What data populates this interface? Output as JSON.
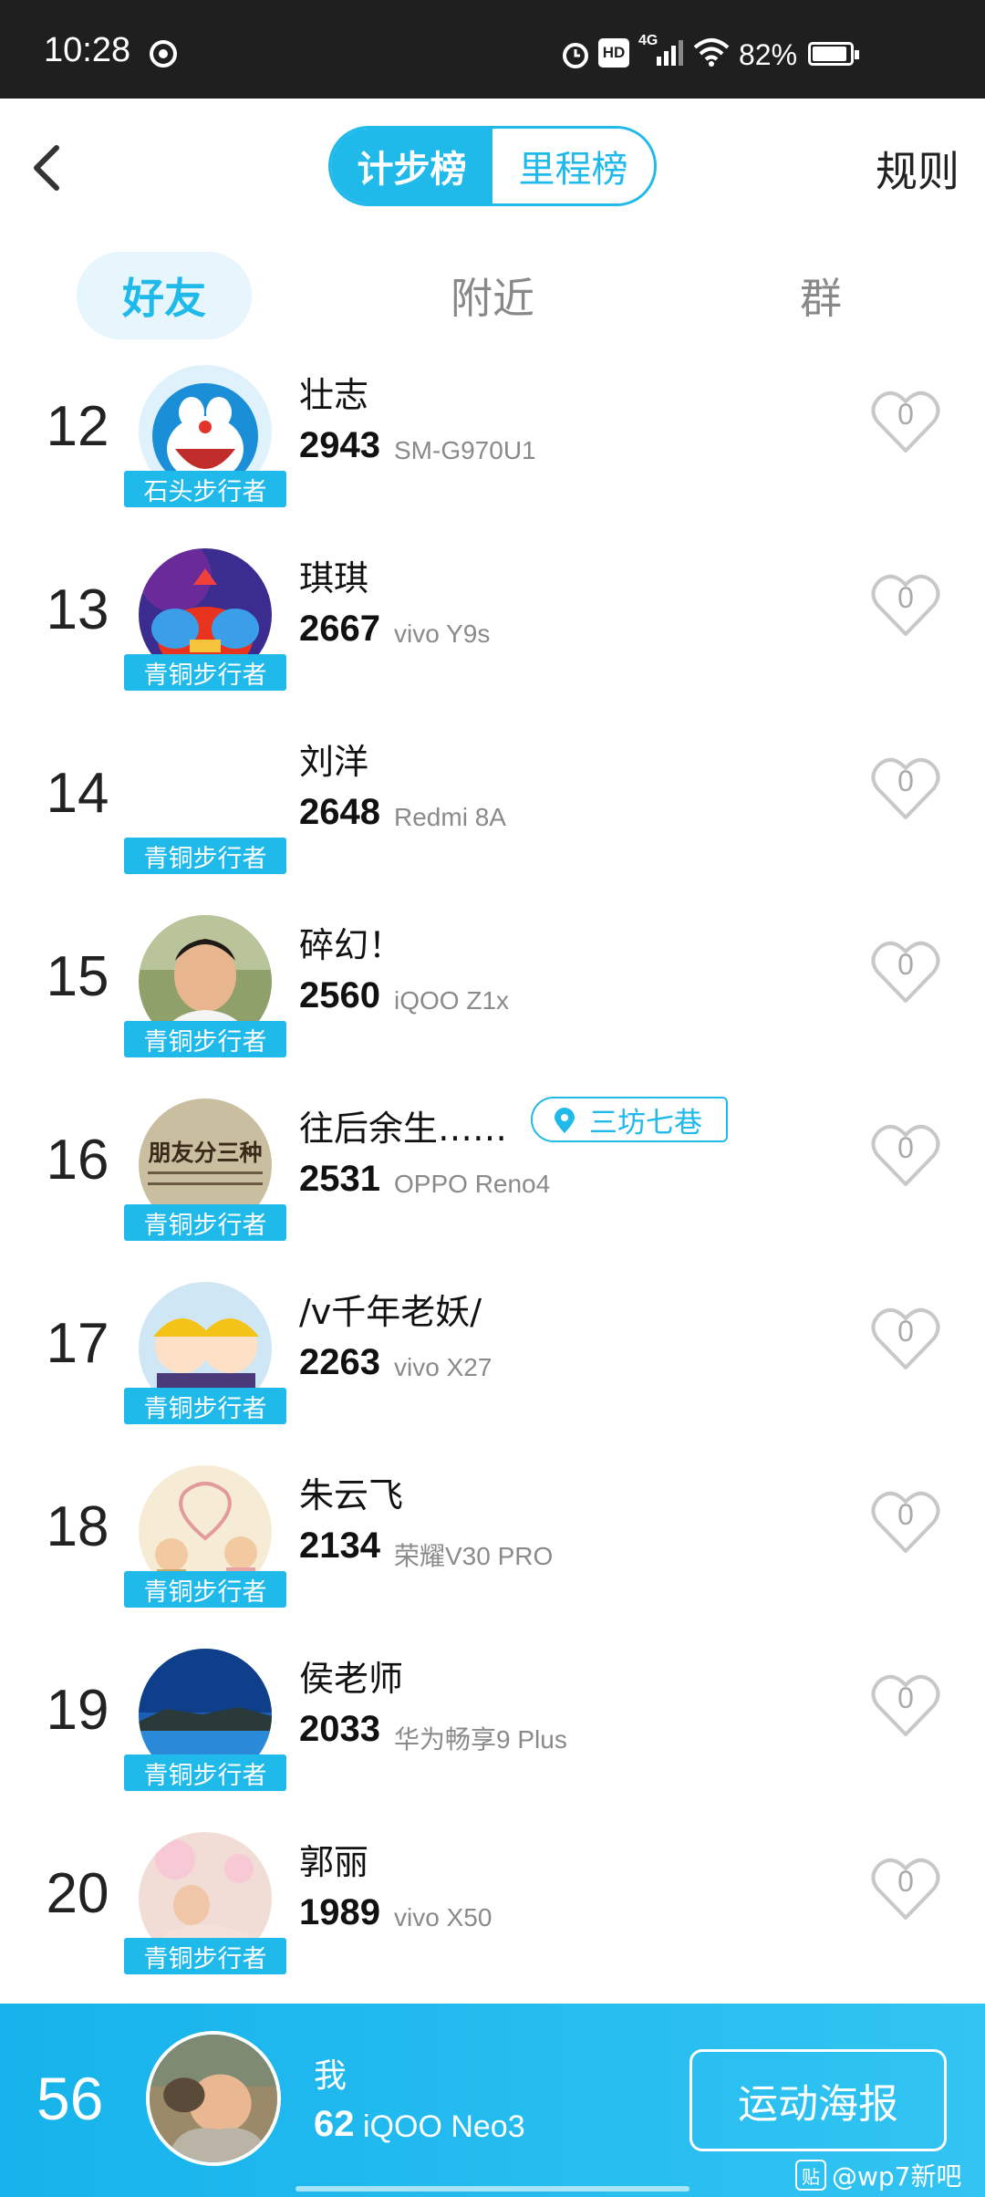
{
  "status_bar": {
    "time": "10:28",
    "battery": "82%",
    "network": "4G",
    "hd": "HD"
  },
  "header": {
    "tabs": [
      {
        "label": "计步榜",
        "active": true
      },
      {
        "label": "里程榜",
        "active": false
      }
    ],
    "rules_label": "规则"
  },
  "subtabs": [
    {
      "label": "好友",
      "active": true
    },
    {
      "label": "附近",
      "active": false
    },
    {
      "label": "群",
      "active": false
    }
  ],
  "entries": [
    {
      "rank": "12",
      "name": "壮志",
      "steps": "2943",
      "device": "SM-G970U1",
      "badge": "石头步行者",
      "likes": "0"
    },
    {
      "rank": "13",
      "name": "琪琪",
      "steps": "2667",
      "device": "vivo Y9s",
      "badge": "青铜步行者",
      "likes": "0"
    },
    {
      "rank": "14",
      "name": "刘洋",
      "steps": "2648",
      "device": "Redmi 8A",
      "badge": "青铜步行者",
      "likes": "0"
    },
    {
      "rank": "15",
      "name": "碎幻！",
      "steps": "2560",
      "device": "iQOO Z1x",
      "badge": "青铜步行者",
      "likes": "0"
    },
    {
      "rank": "16",
      "name": "往后余生……",
      "steps": "2531",
      "device": "OPPO Reno4",
      "badge": "青铜步行者",
      "likes": "0",
      "location": "三坊七巷",
      "avatar_text": "朋友分三种"
    },
    {
      "rank": "17",
      "name": "/v千年老妖/",
      "steps": "2263",
      "device": "vivo X27",
      "badge": "青铜步行者",
      "likes": "0"
    },
    {
      "rank": "18",
      "name": "朱云飞",
      "steps": "2134",
      "device": "荣耀V30 PRO",
      "badge": "青铜步行者",
      "likes": "0"
    },
    {
      "rank": "19",
      "name": "侯老师",
      "steps": "2033",
      "device": "华为畅享9 Plus",
      "badge": "青铜步行者",
      "likes": "0"
    },
    {
      "rank": "20",
      "name": "郭丽",
      "steps": "1989",
      "device": "vivo X50",
      "badge": "青铜步行者",
      "likes": "0"
    }
  ],
  "me": {
    "rank": "56",
    "name": "我",
    "steps": "62",
    "device": "iQOO Neo3",
    "poster_label": "运动海报"
  },
  "watermark": {
    "icon_text": "贴",
    "text": "@wp7新吧"
  },
  "colors": {
    "accent": "#1fb9ea",
    "badge": "#1fb9ea",
    "bottom_bar": "#1fb0ea"
  }
}
